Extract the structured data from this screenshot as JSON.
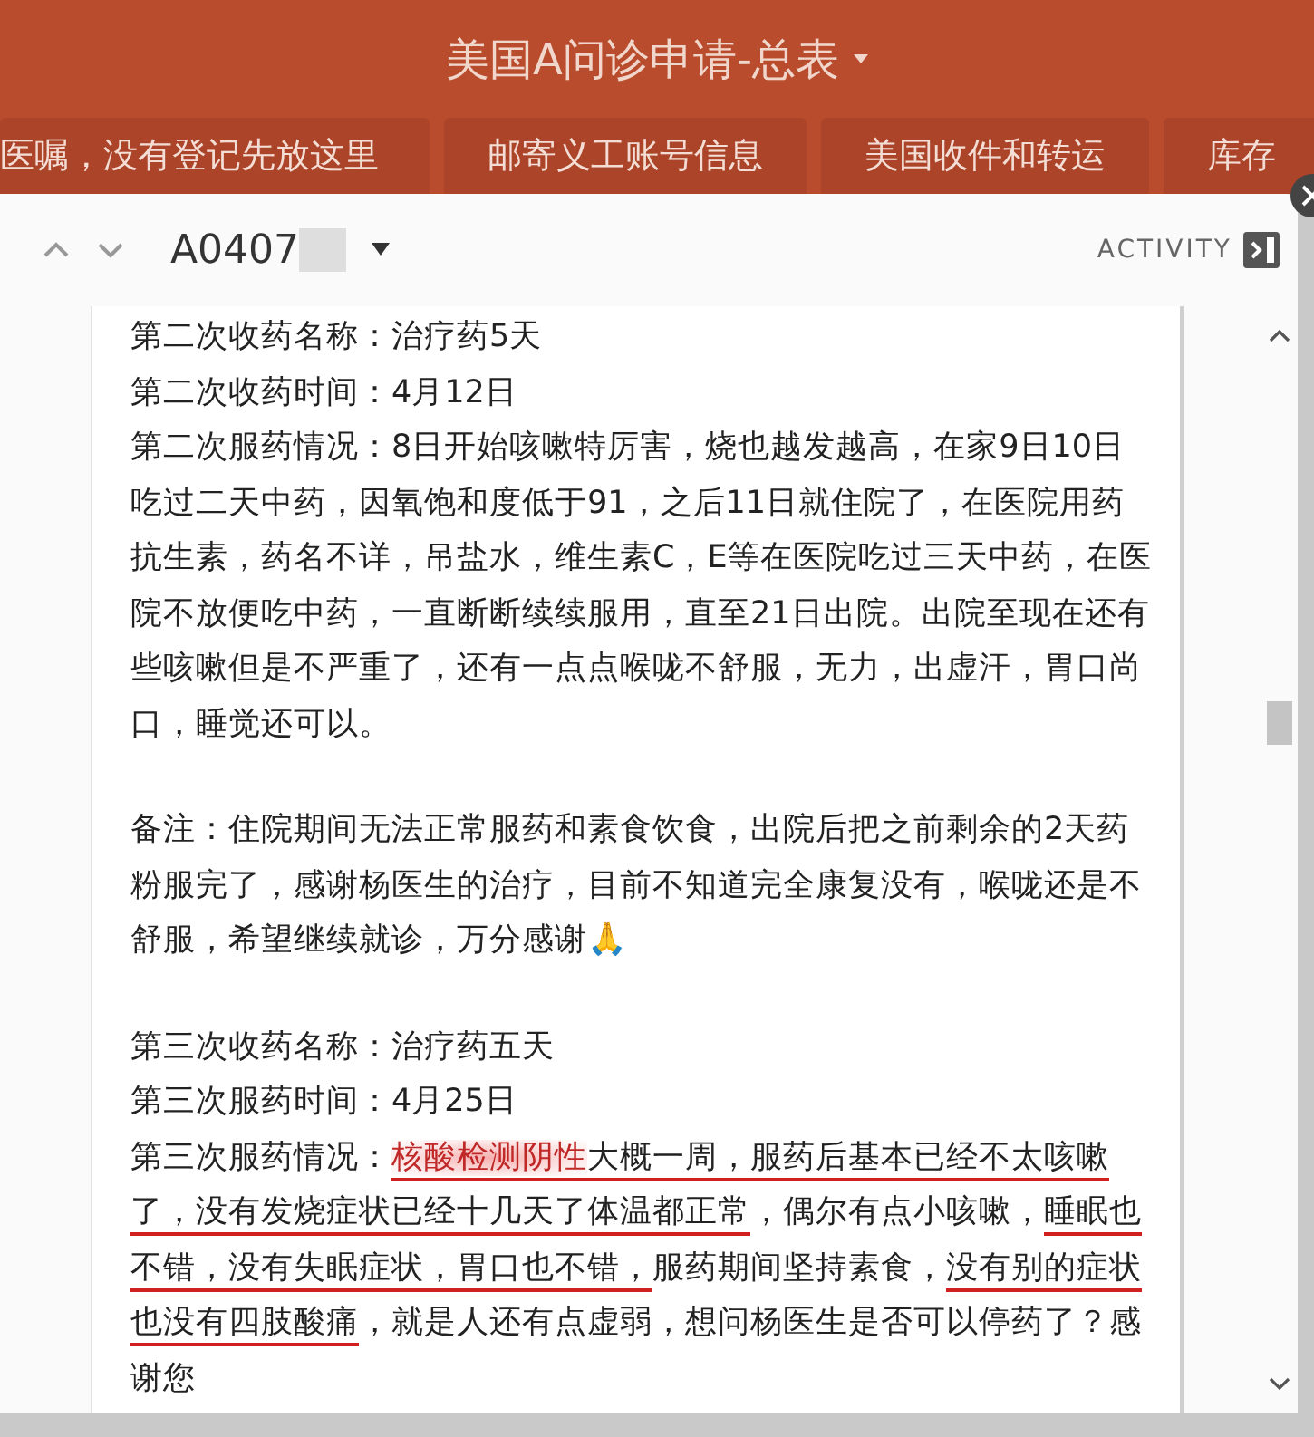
{
  "app_bar": {
    "title": "美国A问诊申请-总表"
  },
  "tabs": [
    {
      "label": "医嘱，没有登记先放这里"
    },
    {
      "label": "邮寄义工账号信息"
    },
    {
      "label": "美国收件和转运"
    },
    {
      "label": "库存"
    }
  ],
  "record": {
    "id": "A0407",
    "activity_label": "ACTIVITY"
  },
  "sections": [
    {
      "lines": [
        {
          "segments": [
            {
              "kind": "plain",
              "text": "第二次收药名称：治疗药5天"
            }
          ]
        },
        {
          "segments": [
            {
              "kind": "plain",
              "text": "第二次收药时间：4月12日"
            }
          ]
        },
        {
          "segments": [
            {
              "kind": "plain",
              "text": "第二次服药情况：8日开始咳嗽特厉害，烧也越发越高，在家9日10日吃过二天中药，因氧饱和度低于91，之后11日就住院了，在医院用药抗生素，药名不详，吊盐水，维生素C，E等在医院吃过三天中药，在医院不放便吃中药，一直断断续续服用，直至21日出院。出院至现在还有些咳嗽但是不严重了，还有一点点喉咙不舒服，无力，出虚汗，胃口尚口，睡觉还可以。"
            }
          ]
        }
      ]
    },
    {
      "lines": [
        {
          "segments": [
            {
              "kind": "plain",
              "text": "备注：住院期间无法正常服药和素食饮食，出院后把之前剩余的2天药粉服完了，感谢杨医生的治疗，目前不知道完全康复没有，喉咙还是不舒服，希望继续就诊，万分感谢🙏"
            }
          ]
        }
      ]
    },
    {
      "lines": [
        {
          "segments": [
            {
              "kind": "plain",
              "text": "第三次收药名称：治疗药五天"
            }
          ]
        },
        {
          "segments": [
            {
              "kind": "plain",
              "text": "第三次服药时间：4月25日"
            }
          ]
        },
        {
          "segments": [
            {
              "kind": "plain",
              "text": "第三次服药情况："
            },
            {
              "kind": "highlight",
              "text": "核酸检测阴性"
            },
            {
              "kind": "underline",
              "text": "大概一周，服药后基本已经不太咳嗽了，没有发烧症状已经十几天了体温都正常"
            },
            {
              "kind": "plain",
              "text": "，偶尔有点小咳嗽，"
            },
            {
              "kind": "underline",
              "text": "睡眠也不错，没有失眠症状，胃口也不错，"
            },
            {
              "kind": "plain",
              "text": "服药期间坚持素食，"
            },
            {
              "kind": "underline",
              "text": "没有别的症状也没有四肢酸痛"
            },
            {
              "kind": "plain",
              "text": "，就是人还有点虚弱，想问杨医生是否可以停药了？感谢您"
            }
          ]
        }
      ]
    }
  ]
}
